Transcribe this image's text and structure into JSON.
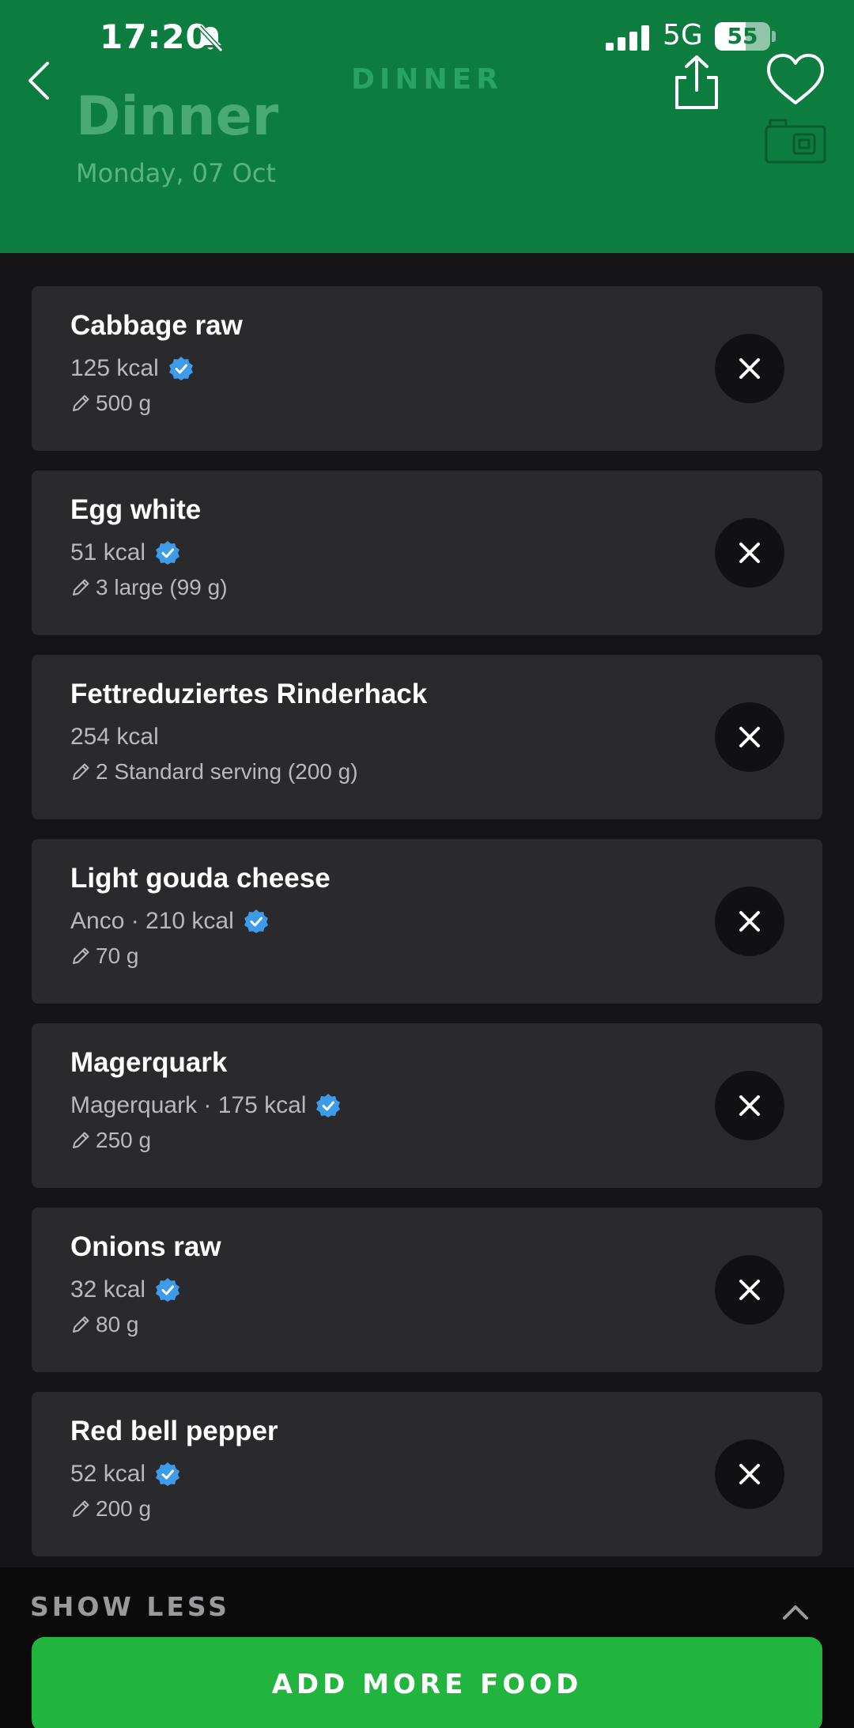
{
  "status_bar": {
    "time": "17:20",
    "network": "5G",
    "battery": "55",
    "battery_level": 0.55
  },
  "header": {
    "caption": "DINNER",
    "title": "Dinner",
    "date": "Monday, 07 Oct",
    "icons": [
      "back-icon",
      "share-icon",
      "heart-icon",
      "camera-icon"
    ]
  },
  "foods": [
    {
      "name": "Cabbage raw",
      "kcal": "125 kcal",
      "verified": true,
      "portion": "500 g"
    },
    {
      "name": "Egg white",
      "kcal": "51 kcal",
      "verified": true,
      "portion": "3 large (99 g)"
    },
    {
      "name": "Fettreduziertes Rinderhack",
      "kcal": "254 kcal",
      "verified": false,
      "portion": "2 Standard serving (200 g)"
    },
    {
      "name": "Light gouda cheese",
      "kcal": "Anco · 210 kcal",
      "verified": true,
      "portion": "70 g"
    },
    {
      "name": "Magerquark",
      "kcal": "Magerquark · 175 kcal",
      "verified": true,
      "portion": "250 g"
    },
    {
      "name": "Onions raw",
      "kcal": "32 kcal",
      "verified": true,
      "portion": "80 g"
    },
    {
      "name": "Red bell pepper",
      "kcal": "52 kcal",
      "verified": true,
      "portion": "200 g"
    }
  ],
  "footer": {
    "show_less": "SHOW LESS",
    "add_more": "ADD MORE FOOD"
  },
  "colors": {
    "header_green": "#0c7d3e",
    "button_green": "#21b43e",
    "verified_blue": "#3d9be9",
    "card_bg": "#2a2a2c",
    "page_bg": "#151517"
  }
}
